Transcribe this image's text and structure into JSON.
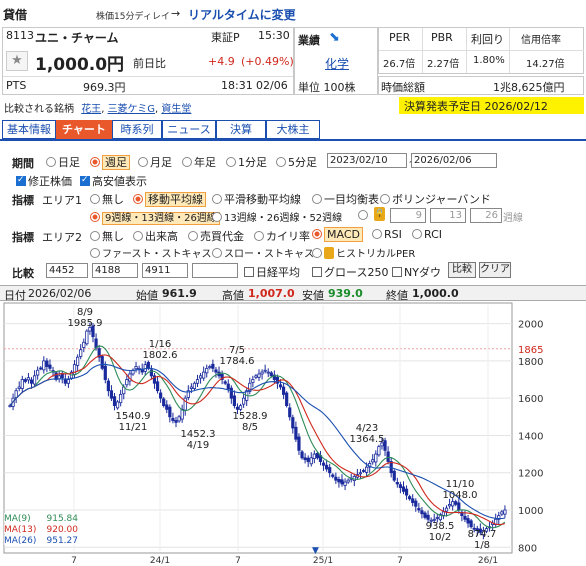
{
  "header": {
    "market_type": "貸借",
    "delay_note": "株価15分ディレイ",
    "arrow": "→",
    "realtime_link": "リアルタイムに変更"
  },
  "stock": {
    "code": "8113",
    "name": "ユニ・チャーム",
    "market": "東証P",
    "time": "15:30",
    "price": "1,000.0円",
    "prev_label": "前日比",
    "change": "+4.9",
    "change_pct": "(+0.49%)",
    "pts_label": "PTS",
    "pts_price": "969.3円",
    "pts_time": "18:31",
    "pts_date": "02/06",
    "sector_label": "業績",
    "sector": "化学",
    "unit": "単位 100株",
    "compare_label": "比較される銘柄",
    "compare": [
      "花王",
      "三菱ケミG",
      "資生堂"
    ]
  },
  "metrics": {
    "per_label": "PER",
    "per": "26.7倍",
    "pbr_label": "PBR",
    "pbr": "2.27倍",
    "yield_label": "利回り",
    "yield": "1.80%",
    "margin_label": "信用倍率",
    "margin": "14.27倍",
    "mcap_label": "時価総額",
    "mcap": "1兆8,625億円",
    "earnings": "決算発表予定日 2026/02/12"
  },
  "tabs": [
    "基本情報",
    "チャート",
    "時系列",
    "ニュース",
    "決算",
    "大株主"
  ],
  "settings": {
    "period_label": "期間",
    "periods": [
      "日足",
      "週足",
      "月足",
      "年足",
      "1分足",
      "5分足"
    ],
    "date_from": "2023/02/10",
    "date_sep": "～",
    "date_to": "2026/02/06",
    "adj_label": "修正株価",
    "hl_label": "高安値表示",
    "ind_label": "指標",
    "area1_label": "エリア1",
    "area1_opts": [
      "無し",
      "移動平均線",
      "平滑移動平均線",
      "一目均衡表",
      "ボリンジャーバンド"
    ],
    "ma_set1": "9週線・13週線・26週線",
    "ma_set2": "13週線・26週線・52週線",
    "ma_custom": [
      "9",
      "13",
      "26"
    ],
    "ma_custom_suffix": "週線",
    "area2_label": "エリア2",
    "area2_opts": [
      "無し",
      "出来高",
      "売買代金",
      "カイリ率",
      "MACD",
      "RSI",
      "RCI"
    ],
    "area2_opts2": [
      "ファースト・ストキャス",
      "スロー・ストキャス",
      "ヒストリカルPER"
    ],
    "cmp_label": "比較",
    "cmp_codes": [
      "4452",
      "4188",
      "4911",
      ""
    ],
    "cmp_opts": [
      "日経平均",
      "グロース250",
      "NYダウ"
    ],
    "cmp_button": "比較",
    "clear_button": "クリア"
  },
  "chart_header": {
    "date_label": "日付",
    "date": "2026/02/06",
    "open_label": "始値",
    "open": "961.9",
    "high_label": "高値",
    "high": "1,007.0",
    "low_label": "安値",
    "low": "939.0",
    "close_label": "終値",
    "close": "1,000.0"
  },
  "colors": {
    "accent": "#e8582a",
    "link": "#1a4fb0",
    "up": "#d0281c",
    "candle": "#1a2a9c",
    "ma9": "#2e8b57",
    "ma13": "#d0281c",
    "ma26": "#1a4fb0"
  },
  "chart_data": {
    "type": "candlestick",
    "y_ticks": [
      800,
      1000,
      1200,
      1400,
      1600,
      1800,
      2000
    ],
    "ylim": [
      780,
      2100
    ],
    "current_price_label": "1865",
    "x_ticks": [
      "7",
      "24/1",
      "7",
      "25/1",
      "7",
      "26/1"
    ],
    "annotations": [
      {
        "date": "8/9",
        "value": "1985.9",
        "type": "high"
      },
      {
        "date": "1/16",
        "value": "1802.6",
        "type": "high"
      },
      {
        "date": "7/5",
        "value": "1784.6",
        "type": "high"
      },
      {
        "date": "11/21",
        "value": "1540.9",
        "type": "low"
      },
      {
        "date": "4/19",
        "value": "1452.3",
        "type": "low"
      },
      {
        "date": "8/5",
        "value": "1528.9",
        "type": "low"
      },
      {
        "date": "4/23",
        "value": "1364.5",
        "type": "high"
      },
      {
        "date": "11/10",
        "value": "1048.0",
        "type": "high"
      },
      {
        "date": "10/2",
        "value": "938.5",
        "type": "low"
      },
      {
        "date": "1/8",
        "value": "874.7",
        "type": "low"
      }
    ],
    "series_close": [
      1560,
      1600,
      1640,
      1660,
      1700,
      1690,
      1710,
      1680,
      1720,
      1750,
      1760,
      1800,
      1770,
      1760,
      1740,
      1700,
      1720,
      1710,
      1680,
      1700,
      1740,
      1780,
      1820,
      1860,
      1900,
      1960,
      1980,
      1930,
      1870,
      1820,
      1760,
      1700,
      1640,
      1600,
      1560,
      1580,
      1620,
      1660,
      1700,
      1730,
      1750,
      1770,
      1760,
      1740,
      1780,
      1760,
      1720,
      1680,
      1640,
      1600,
      1560,
      1540,
      1500,
      1480,
      1470,
      1500,
      1540,
      1600,
      1640,
      1660,
      1680,
      1700,
      1720,
      1740,
      1760,
      1770,
      1760,
      1740,
      1720,
      1700,
      1680,
      1650,
      1600,
      1560,
      1540,
      1560,
      1600,
      1640,
      1680,
      1700,
      1720,
      1730,
      1740,
      1750,
      1740,
      1720,
      1700,
      1680,
      1660,
      1620,
      1560,
      1500,
      1440,
      1380,
      1320,
      1280,
      1270,
      1260,
      1280,
      1300,
      1280,
      1260,
      1240,
      1220,
      1200,
      1180,
      1160,
      1150,
      1140,
      1150,
      1160,
      1170,
      1180,
      1190,
      1200,
      1210,
      1230,
      1250,
      1270,
      1300,
      1340,
      1360,
      1320,
      1260,
      1200,
      1160,
      1140,
      1120,
      1100,
      1080,
      1060,
      1040,
      1020,
      1000,
      980,
      960,
      950,
      945,
      950,
      960,
      975,
      990,
      1010,
      1030,
      1045,
      1030,
      1000,
      970,
      950,
      930,
      910,
      900,
      890,
      880,
      890,
      900,
      910,
      930,
      950,
      970,
      990,
      1000
    ],
    "series_ma": [
      {
        "name": "MA(9)",
        "value": "915.84"
      },
      {
        "name": "MA(13)",
        "value": "920.00"
      },
      {
        "name": "MA(26)",
        "value": "951.27"
      }
    ]
  }
}
